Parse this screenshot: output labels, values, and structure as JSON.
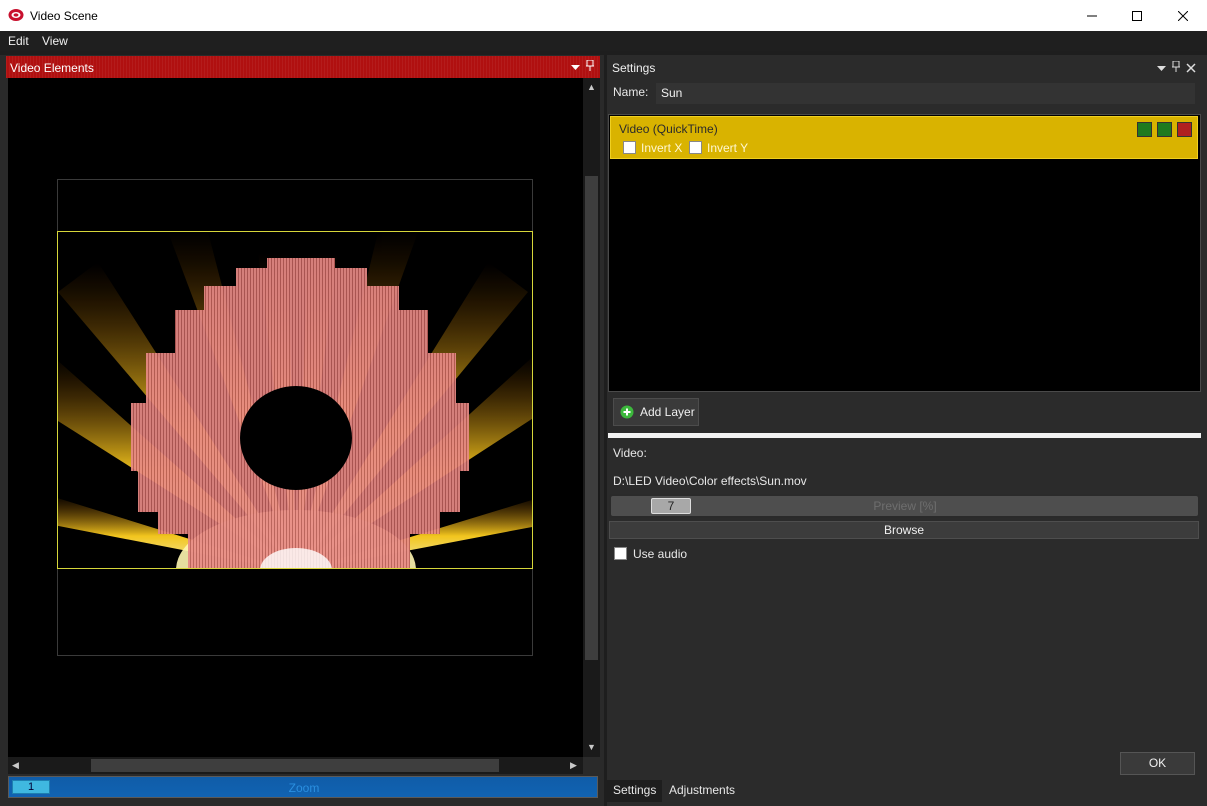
{
  "window": {
    "title": "Video Scene",
    "controls": {
      "minimize": "—",
      "maximize": "☐",
      "close": "✕"
    }
  },
  "menu": {
    "items": [
      "Edit",
      "View"
    ]
  },
  "left_panel": {
    "title": "Video Elements",
    "zoom": {
      "value": "1",
      "label": "Zoom"
    }
  },
  "settings": {
    "title": "Settings",
    "name_label": "Name:",
    "name_value": "Sun",
    "layers": [
      {
        "name": "Video (QuickTime)",
        "invert_x_label": "Invert X",
        "invert_y_label": "Invert Y",
        "invert_x": false,
        "invert_y": false
      }
    ],
    "add_layer_label": "Add Layer",
    "video_label": "Video:",
    "video_path": "D:\\LED Video\\Color effects\\Sun.mov",
    "preview": {
      "value": "7",
      "label": "Preview [%]",
      "fraction": 0.07
    },
    "browse_label": "Browse",
    "use_audio_label": "Use audio",
    "use_audio": false,
    "ok_label": "OK"
  },
  "tabs": [
    {
      "label": "Settings",
      "active": true
    },
    {
      "label": "Adjustments",
      "active": false
    }
  ],
  "colors": {
    "header_red": "#b01010",
    "layer_yellow": "#d9b300",
    "zoom_blue": "#0f5ca8"
  }
}
